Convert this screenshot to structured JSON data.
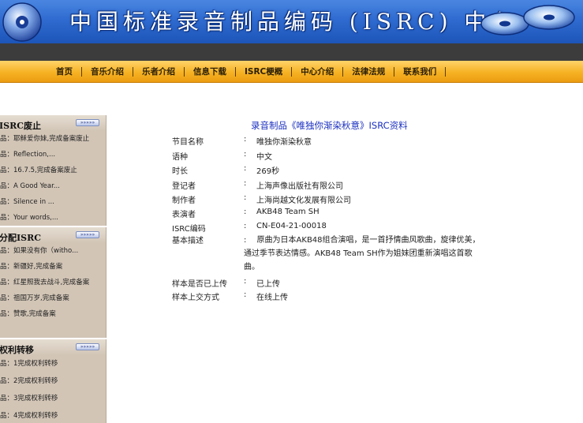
{
  "banner": {
    "title": "中国标准录音制品编码 (ISRC) 中心"
  },
  "nav": {
    "items": [
      "首页",
      "音乐介绍",
      "乐者介绍",
      "信息下载",
      "ISRC梗概",
      "中心介绍",
      "法律法规",
      "联系我们"
    ]
  },
  "sidebar": {
    "more_label": "»»»»»",
    "sections": [
      {
        "title": "ISRC废止",
        "items": [
          "品：耶稣爱你妹,完成备案废止",
          "品：Reflection,...",
          "品：16.7.5,完成备案废止",
          "品：A Good Year...",
          "品：Silence in ...",
          "品：Your words,..."
        ]
      },
      {
        "title": "分配ISRC",
        "items": [
          "品：如果没有你（witho...",
          "品：新疆好,完成备案",
          "品：红星照我去战斗,完成备案",
          "品：祖国万岁,完成备案",
          "品：赞歌,完成备案"
        ]
      },
      {
        "title": "权利转移",
        "items": [
          "品：1完成权利转移",
          "品：2完成权利转移",
          "品：3完成权利转移",
          "品：4完成权利转移"
        ]
      }
    ]
  },
  "record": {
    "title": "录音制品《唯独你渐染秋意》ISRC资料",
    "colon": ":",
    "fields": [
      {
        "label": "节目名称",
        "value": " 唯独你渐染秋意"
      },
      {
        "label": "语种",
        "value": "中文"
      },
      {
        "label": "时长",
        "value": "269秒"
      },
      {
        "label": "登记者",
        "value": "上海声像出版社有限公司"
      },
      {
        "label": "制作者",
        "value": "上海尚越文化发展有限公司"
      },
      {
        "label": "表演者",
        "value": "AKB48 Team SH"
      },
      {
        "label": "ISRC编码",
        "value": "CN-E04-21-00018"
      }
    ],
    "description": {
      "label": "基本描述",
      "value": ":　 原曲为日本AKB48组合演唱，是一首抒情曲风歌曲，旋律优美，通过季节表达情感。AKB48 Team SH作为姐妹团重新演唱这首歌曲。"
    },
    "fields_after": [
      {
        "label": "样本是否已上传",
        "value": "已上传"
      },
      {
        "label": "样本上交方式",
        "value": "在线上传"
      }
    ]
  },
  "colors": {
    "banner_blue": "#2f6bd0",
    "nav_orange": "#f6b223",
    "sidebar_beige": "#d2c5b6",
    "title_blue": "#1a2fbf"
  }
}
